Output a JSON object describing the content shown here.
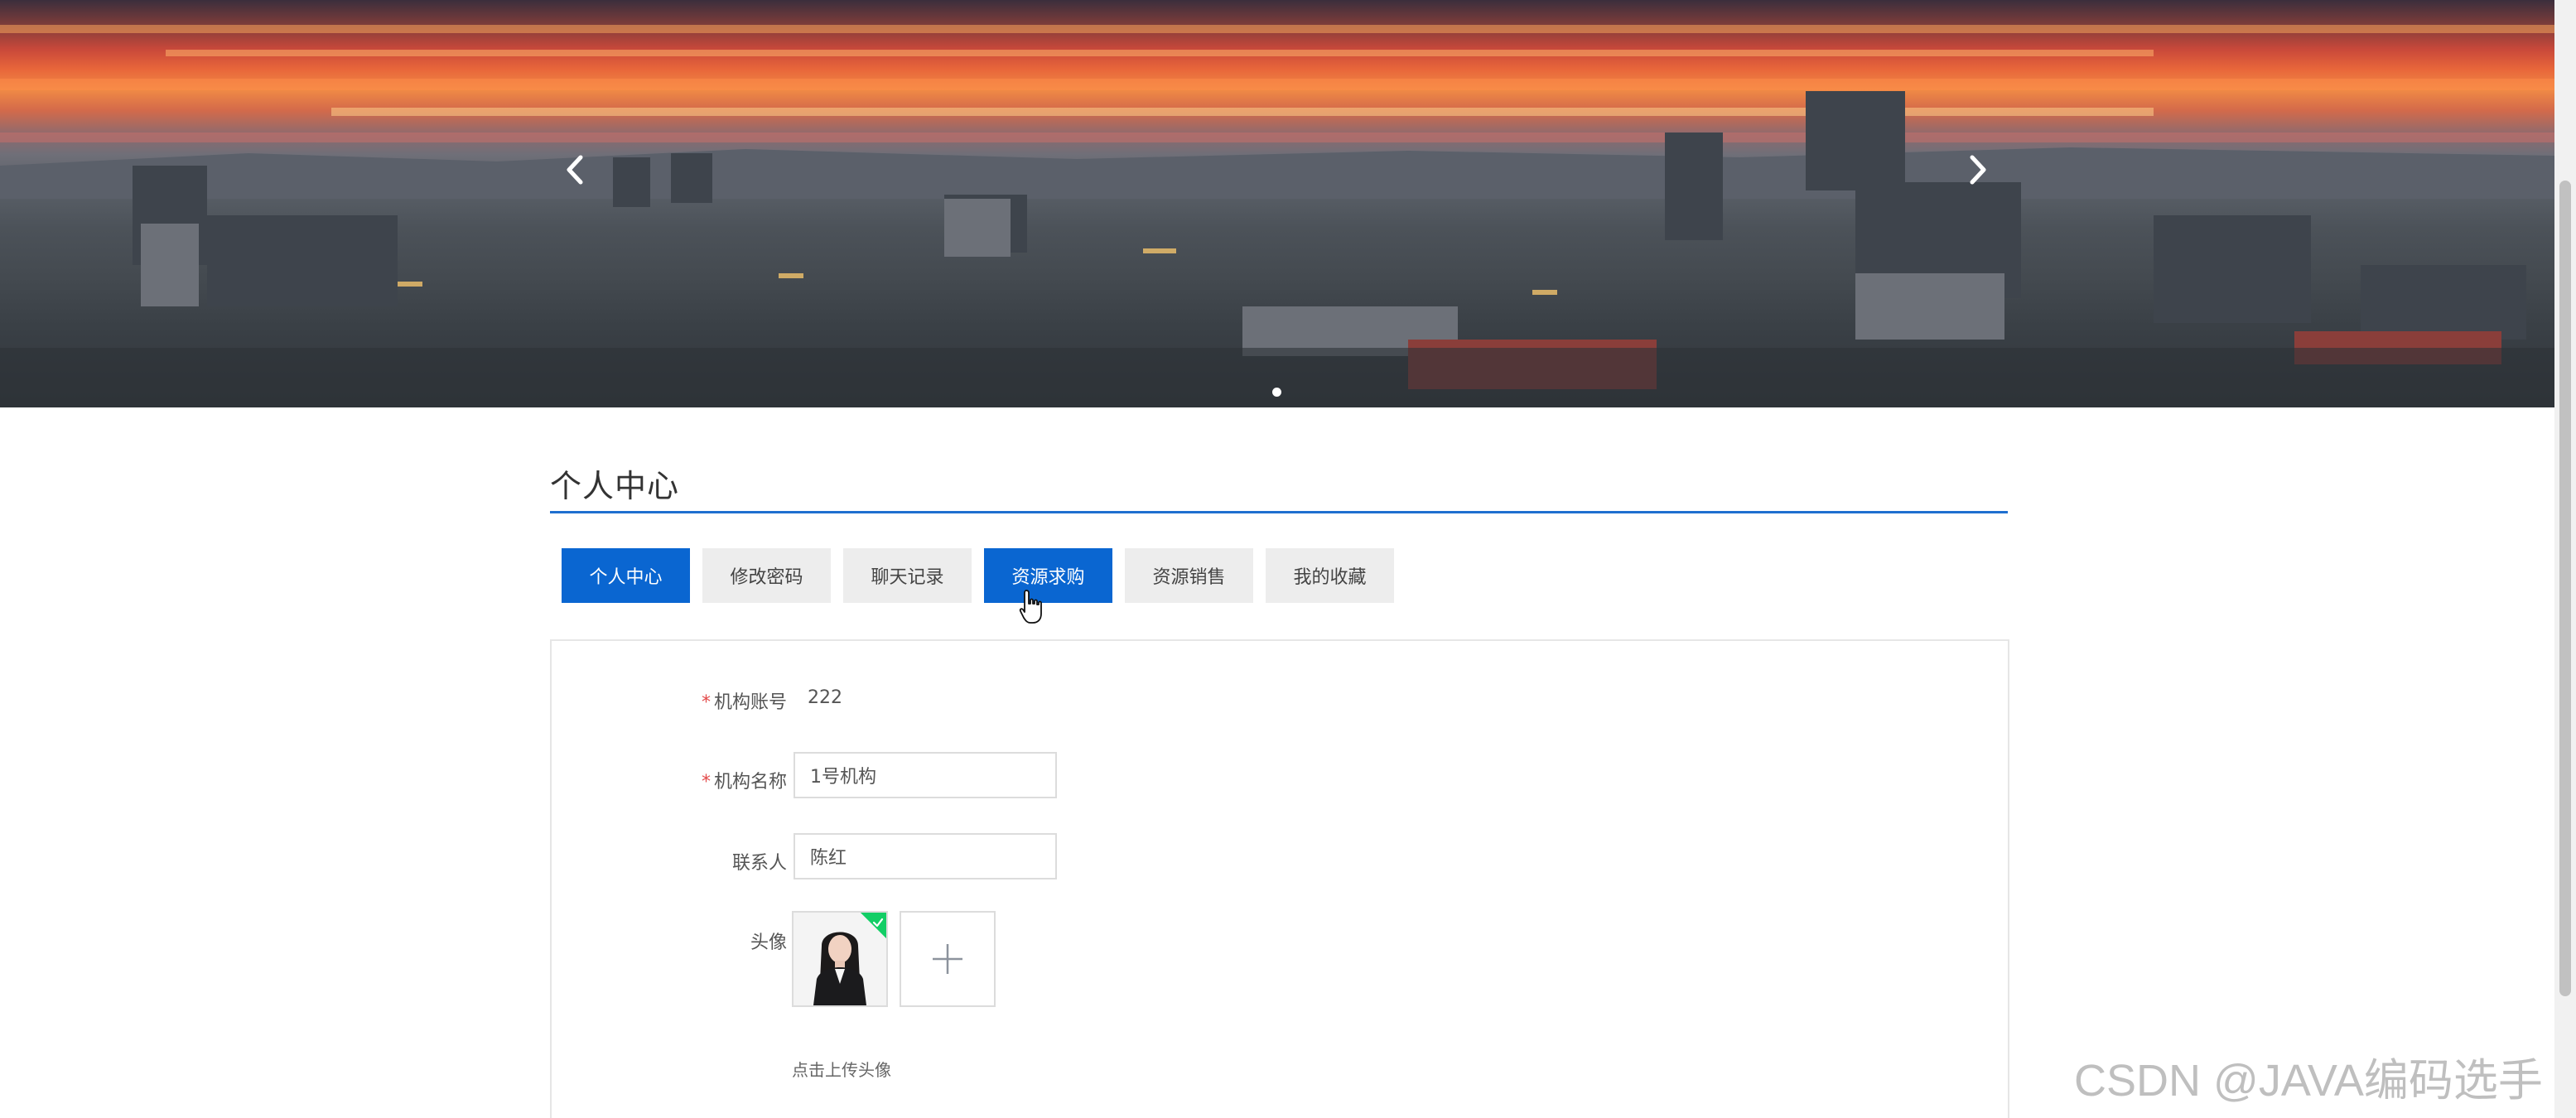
{
  "banner": {
    "active_slide": 1,
    "slide_count": 1,
    "prev_icon": "chevron-left-icon",
    "next_icon": "chevron-right-icon"
  },
  "section": {
    "title": "个人中心"
  },
  "tabs": [
    {
      "label": "个人中心",
      "active": true
    },
    {
      "label": "修改密码",
      "active": false
    },
    {
      "label": "聊天记录",
      "active": false
    },
    {
      "label": "资源求购",
      "active": true
    },
    {
      "label": "资源销售",
      "active": false
    },
    {
      "label": "我的收藏",
      "active": false
    }
  ],
  "form": {
    "account": {
      "label": "机构账号",
      "required_mark": "*",
      "value": "222"
    },
    "name": {
      "label": "机构名称",
      "required_mark": "*",
      "value": "1号机构"
    },
    "contact": {
      "label": "联系人",
      "value": "陈红"
    },
    "avatar": {
      "label": "头像",
      "upload_hint": "点击上传头像",
      "upload_icon": "plus-icon",
      "uploaded_icon": "check-icon"
    }
  },
  "watermark": "CSDN @JAVA编码选手",
  "colors": {
    "accent": "#0a66d1",
    "underline": "#1f6fcf",
    "required": "#e34a4a",
    "success": "#13ce66"
  }
}
